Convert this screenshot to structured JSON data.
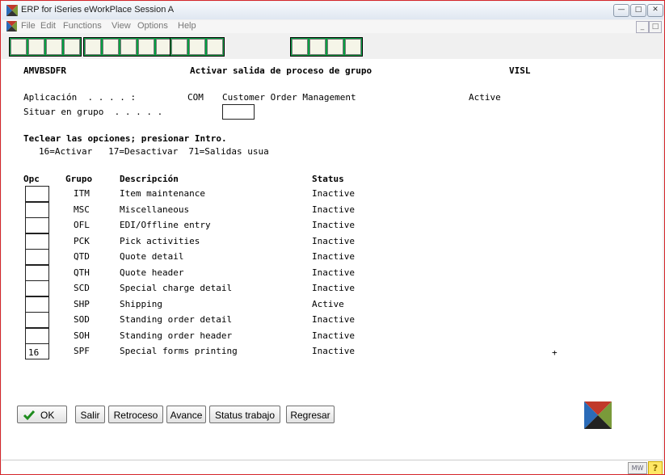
{
  "window": {
    "title": "ERP for iSeries eWorkPlace Session A"
  },
  "menu": [
    "File",
    "Edit",
    "Functions",
    "View",
    "Options",
    "Help"
  ],
  "screen": {
    "program_id": "AMVBSDFR",
    "heading": "Activar salida de proceso de grupo",
    "system": "VISL",
    "app_label": "Aplicación  . . . . :",
    "app_code": "COM",
    "app_name": "Customer Order Management",
    "app_status": "Active",
    "group_label": "Situar en grupo  . . . . .",
    "instructions": "Teclear las opciones; presionar Intro.",
    "options_line": "16=Activar   17=Desactivar  71=Salidas usua",
    "columns": {
      "opc": "Opc",
      "grupo": "Grupo",
      "desc": "Descripción",
      "status": "Status"
    },
    "rows": [
      {
        "opc": "",
        "grupo": "ITM",
        "desc": "Item maintenance",
        "status": "Inactive"
      },
      {
        "opc": "",
        "grupo": "MSC",
        "desc": "Miscellaneous",
        "status": "Inactive"
      },
      {
        "opc": "",
        "grupo": "OFL",
        "desc": "EDI/Offline entry",
        "status": "Inactive"
      },
      {
        "opc": "",
        "grupo": "PCK",
        "desc": "Pick activities",
        "status": "Inactive"
      },
      {
        "opc": "",
        "grupo": "QTD",
        "desc": "Quote detail",
        "status": "Inactive"
      },
      {
        "opc": "",
        "grupo": "QTH",
        "desc": "Quote header",
        "status": "Inactive"
      },
      {
        "opc": "",
        "grupo": "SCD",
        "desc": "Special charge detail",
        "status": "Inactive"
      },
      {
        "opc": "",
        "grupo": "SHP",
        "desc": "Shipping",
        "status": "Active"
      },
      {
        "opc": "",
        "grupo": "SOD",
        "desc": "Standing order detail",
        "status": "Inactive"
      },
      {
        "opc": "",
        "grupo": "SOH",
        "desc": "Standing order header",
        "status": "Inactive"
      },
      {
        "opc": "16",
        "grupo": "SPF",
        "desc": "Special forms printing",
        "status": "Inactive"
      }
    ],
    "more_indicator": "+"
  },
  "buttons": {
    "ok": "OK",
    "salir": "Salir",
    "retroceso": "Retroceso",
    "avance": "Avance",
    "status_trabajo": "Status trabajo",
    "regresar": "Regresar"
  },
  "status_bar": {
    "mw": "MW",
    "help": "?"
  },
  "colors": {
    "border": "#d4262b",
    "toolbar_accent": "#00a040",
    "ok_check": "#1e8c1e"
  }
}
